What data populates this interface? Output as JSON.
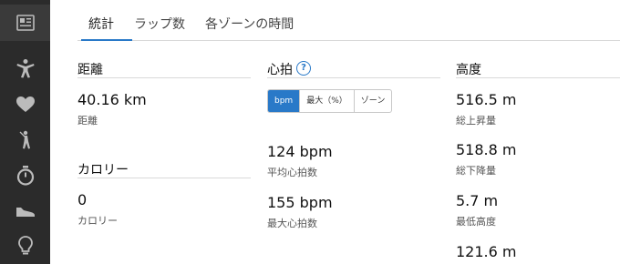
{
  "sidebar": {
    "icons": [
      "summary-card-icon",
      "activity-person-icon",
      "heart-icon",
      "golf-icon",
      "timer-icon",
      "shoe-icon",
      "lightbulb-icon"
    ]
  },
  "tabs": [
    "統計",
    "ラップ数",
    "各ゾーンの時間"
  ],
  "distance": {
    "title": "距離",
    "value": "40.16 km",
    "label": "距離"
  },
  "calories": {
    "title": "カロリー",
    "value": "0",
    "label": "カロリー"
  },
  "heart_rate": {
    "title": "心拍",
    "help": "?",
    "toggle": [
      "bpm",
      "最大（%）",
      "ゾーン"
    ],
    "avg_value": "124 bpm",
    "avg_label": "平均心拍数",
    "max_value": "155 bpm",
    "max_label": "最大心拍数"
  },
  "elevation": {
    "title": "高度",
    "gain_value": "516.5 m",
    "gain_label": "総上昇量",
    "loss_value": "518.8 m",
    "loss_label": "総下降量",
    "min_value": "5.7 m",
    "min_label": "最低高度",
    "max_value": "121.6 m"
  },
  "colors": {
    "accent": "#2979c8",
    "sidebar": "#2b2b2b"
  }
}
